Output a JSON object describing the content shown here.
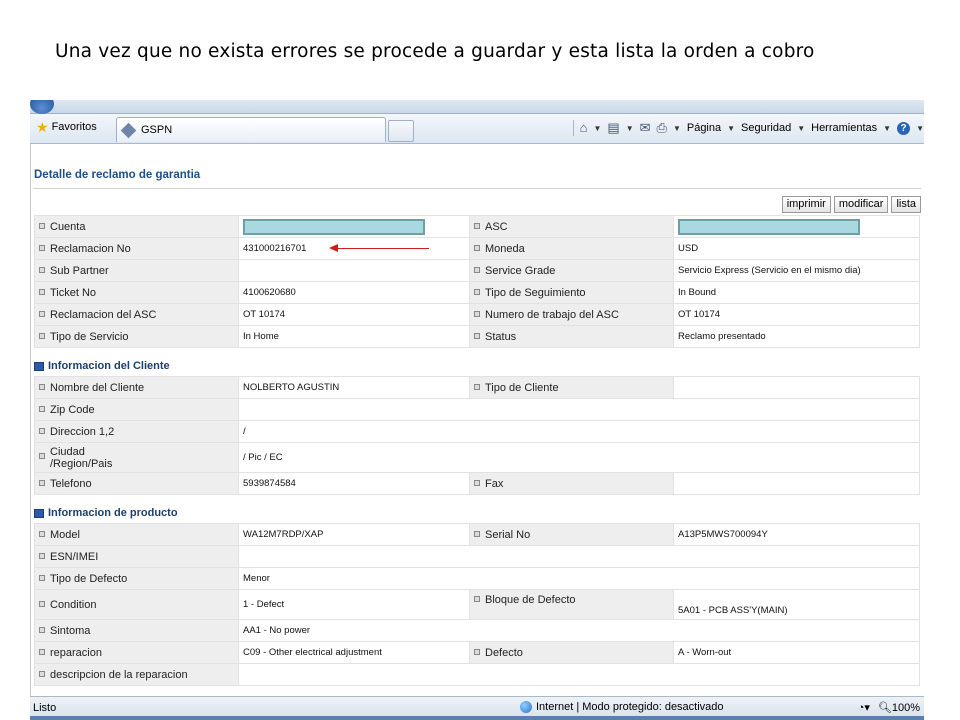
{
  "caption": "Una vez que no exista errores se procede a guardar y esta lista la orden a cobro",
  "browser": {
    "favorites_label": "Favoritos",
    "tab_title": "GSPN",
    "toolbar": {
      "page": "Página",
      "security": "Seguridad",
      "tools": "Herramientas"
    },
    "status_left": "Listo",
    "status_zone": "Internet | Modo protegido: desactivado",
    "zoom": "100%"
  },
  "page": {
    "title": "Detalle de reclamo de garantia",
    "buttons": {
      "print": "imprimir",
      "modify": "modificar",
      "list": "lista"
    },
    "claim": [
      {
        "l1": "Cuenta",
        "v1": "",
        "l2": "ASC",
        "v2": ""
      },
      {
        "l1": "Reclamacion No",
        "v1": "431000216701",
        "l2": "Moneda",
        "v2": "USD"
      },
      {
        "l1": "Sub Partner",
        "v1": "",
        "l2": "Service Grade",
        "v2": "Servicio Express (Servicio en el mismo dia)"
      },
      {
        "l1": "Ticket No",
        "v1": "4100620680",
        "l2": "Tipo de Seguimiento",
        "v2": "In Bound"
      },
      {
        "l1": "Reclamacion del ASC",
        "v1": "OT 10174",
        "l2": "Numero de trabajo del ASC",
        "v2": "OT 10174"
      },
      {
        "l1": "Tipo de Servicio",
        "v1": "In Home",
        "l2": "Status",
        "v2": "Reclamo presentado"
      }
    ],
    "client_section": "Informacion del Cliente",
    "client": {
      "name_label": "Nombre del Cliente",
      "name": "NOLBERTO AGUSTIN",
      "type_label": "Tipo de Cliente",
      "type": "",
      "zip_label": "Zip Code",
      "zip": "",
      "address_label": "Direccion 1,2",
      "address": "/",
      "city_label_1": "Ciudad",
      "city_label_2": "/Region/Pais",
      "city": "/ Pic  / EC",
      "phone_label": "Telefono",
      "phone": "5939874584",
      "fax_label": "Fax",
      "fax": ""
    },
    "product_section": "Informacion de producto",
    "product": {
      "model_label": "Model",
      "model": "WA12M7RDP/XAP",
      "serial_label": "Serial No",
      "serial": "A13P5MWS700094Y",
      "esn_label": "ESN/IMEI",
      "esn": "",
      "defect_type_label": "Tipo de Defecto",
      "defect_type": "Menor",
      "condition_label": "Condition",
      "condition": "1 - Defect",
      "defect_block_label": "Bloque de Defecto",
      "defect_block": "5A01 - PCB ASS'Y(MAIN)",
      "symptom_label": "Sintoma",
      "symptom": "AA1 - No power",
      "repair_label": "reparacion",
      "repair": "C09 - Other electrical adjustment",
      "defect_label": "Defecto",
      "defect": "A - Worn-out",
      "repair_desc_label": "descripcion de la reparacion",
      "repair_desc": ""
    }
  }
}
